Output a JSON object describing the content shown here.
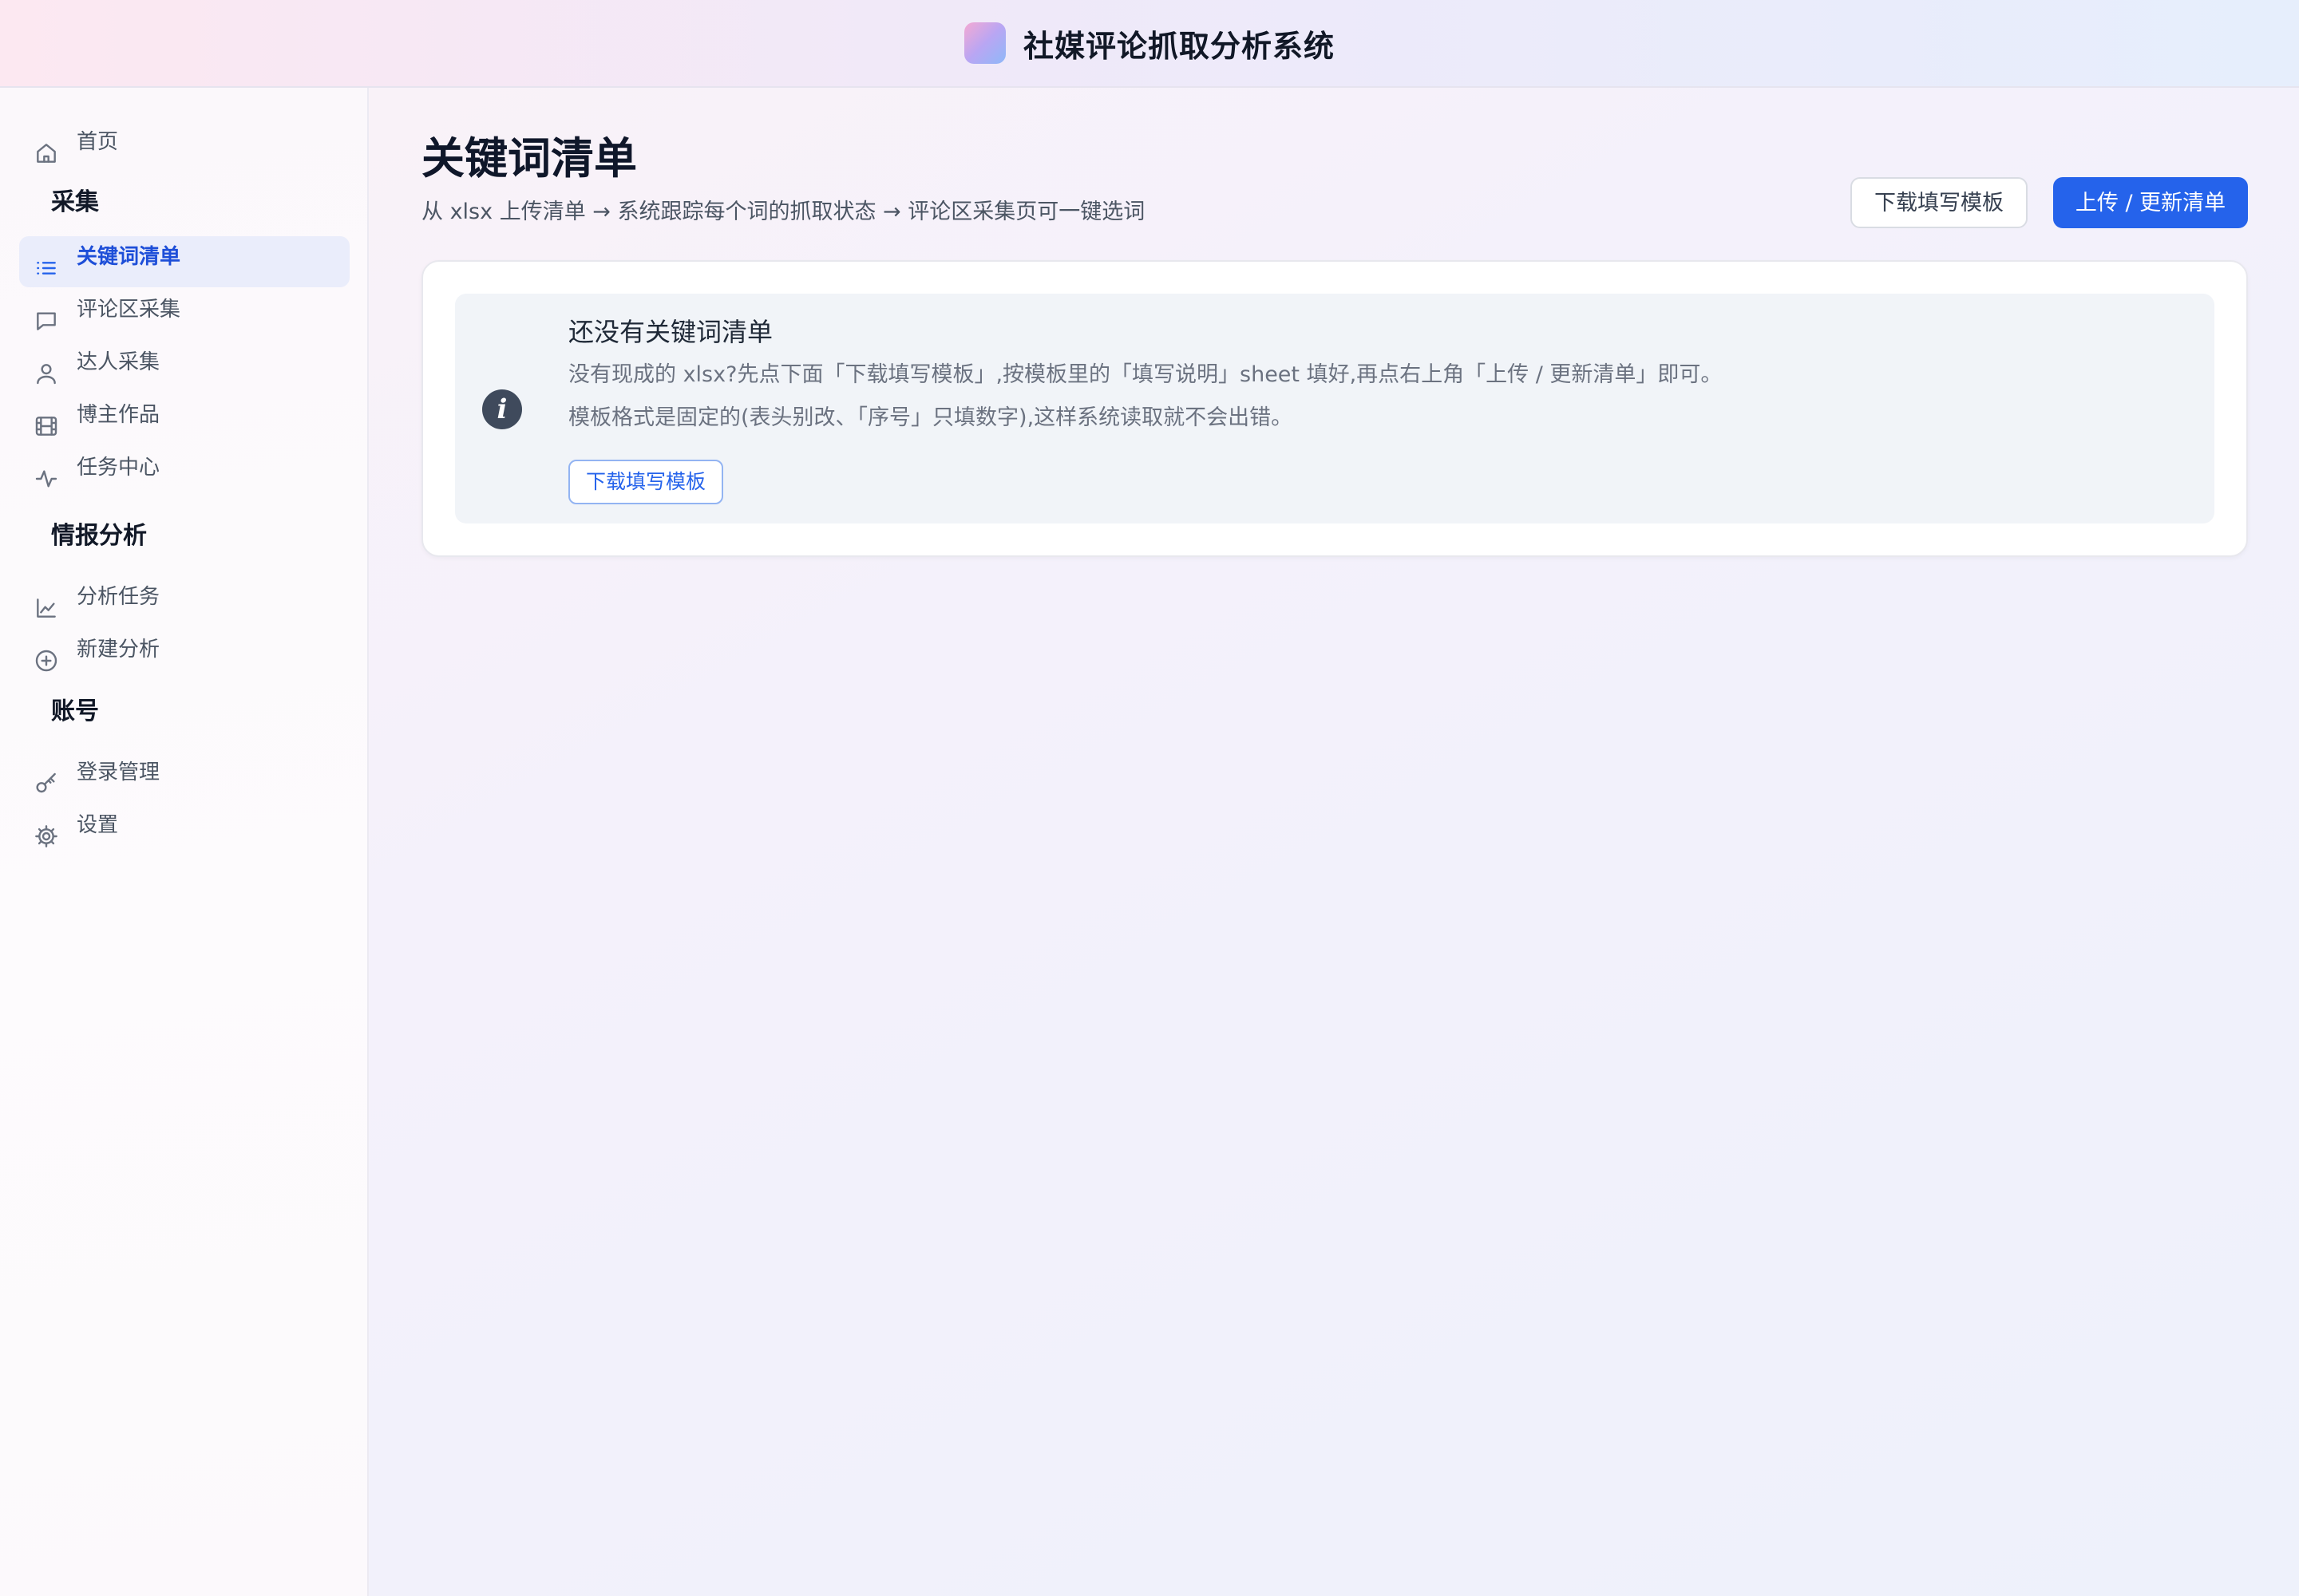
{
  "header": {
    "title": "社媒评论抓取分析系统"
  },
  "sidebar": {
    "home": {
      "label": "首页",
      "icon": "home-icon"
    },
    "sections": [
      {
        "title": "采集",
        "items": [
          {
            "label": "关键词清单",
            "icon": "list-icon",
            "active": true
          },
          {
            "label": "评论区采集",
            "icon": "message-icon"
          },
          {
            "label": "达人采集",
            "icon": "user-icon"
          },
          {
            "label": "博主作品",
            "icon": "film-icon"
          },
          {
            "label": "任务中心",
            "icon": "activity-icon"
          }
        ]
      },
      {
        "title": "情报分析",
        "items": [
          {
            "label": "分析任务",
            "icon": "line-chart-icon"
          },
          {
            "label": "新建分析",
            "icon": "plus-circle-icon"
          }
        ]
      },
      {
        "title": "账号",
        "items": [
          {
            "label": "登录管理",
            "icon": "key-icon"
          },
          {
            "label": "设置",
            "icon": "gear-icon"
          }
        ]
      }
    ]
  },
  "main": {
    "title": "关键词清单",
    "subtitle": "从 xlsx 上传清单 → 系统跟踪每个词的抓取状态 → 评论区采集页可一键选词",
    "actions": {
      "download_template": "下载填写模板",
      "upload": "上传 / 更新清单"
    },
    "empty_state": {
      "title": "还没有关键词清单",
      "line1": "没有现成的 xlsx?先点下面「下载填写模板」,按模板里的「填写说明」sheet 填好,再点右上角「上传 / 更新清单」即可。",
      "line2": "模板格式是固定的(表头别改、「序号」只填数字),这样系统读取就不会出错。",
      "button": "下载填写模板"
    }
  },
  "colors": {
    "accent": "#2563eb",
    "active_bg": "#eaedfb"
  }
}
